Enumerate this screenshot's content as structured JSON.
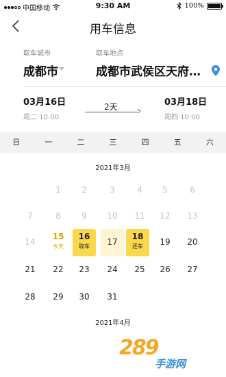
{
  "status_bar": {
    "carrier": "中国移动",
    "time": "9:30 AM",
    "battery": "100%"
  },
  "header": {
    "title": "用车信息"
  },
  "pickup": {
    "city_label": "取车城市",
    "city": "成都市",
    "place_label": "取车地点",
    "place": "成都市武侯区天府…"
  },
  "rental": {
    "start_date": "03月16日",
    "start_time": "周二 10:00",
    "duration": "2天",
    "end_date": "03月18日",
    "end_time": "周四 10:00"
  },
  "weekdays": [
    "日",
    "一",
    "二",
    "三",
    "四",
    "五",
    "六"
  ],
  "calendar": {
    "march_title": "2021年3月",
    "april_title": "2021年4月",
    "week1": [
      "1",
      "2",
      "3",
      "4",
      "5",
      "6"
    ],
    "week2": [
      "7",
      "8",
      "9",
      "10",
      "11",
      "12",
      "13"
    ],
    "week3": [
      "14",
      "15",
      "16",
      "17",
      "18",
      "19",
      "20"
    ],
    "week4": [
      "21",
      "22",
      "23",
      "24",
      "25",
      "26",
      "27"
    ],
    "week5": [
      "28",
      "29",
      "30",
      "31"
    ],
    "today_label": "今天",
    "pickup_label": "取车",
    "return_label": "还车"
  },
  "watermark": {
    "number": "289",
    "site": "手游网"
  },
  "colors": {
    "accent": "#fbd74b",
    "today": "#e3a300",
    "range": "#fdf4d3",
    "pin": "#3b8fd8"
  }
}
